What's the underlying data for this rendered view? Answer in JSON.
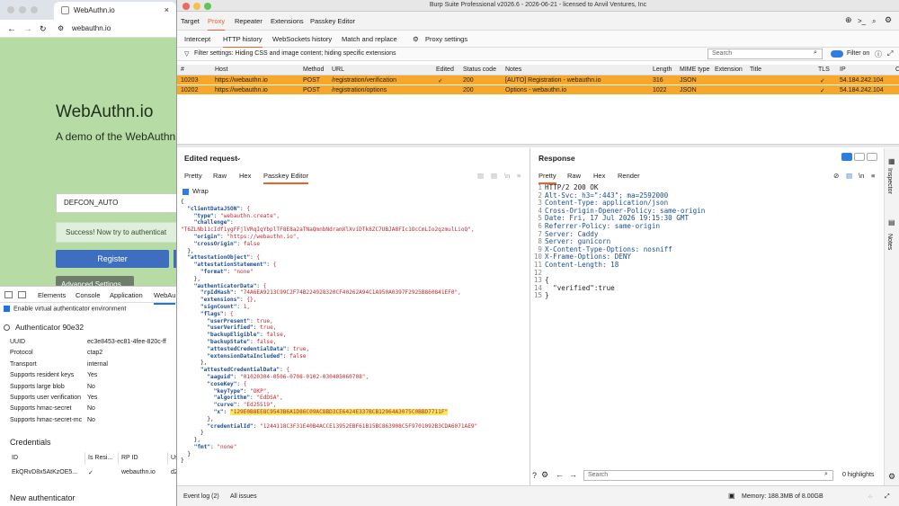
{
  "browser": {
    "tab_title": "WebAuthn.io",
    "address": "webauthn.io",
    "page": {
      "heading": "WebAuthn.io",
      "subheading": "A demo of the WebAuthn",
      "username_value": "DEFCON_AUTO",
      "success_text": "Success! Now try to authenticat",
      "register_label": "Register",
      "advanced_label": "Advanced Settings"
    },
    "devtools": {
      "tabs": [
        "Elements",
        "Console",
        "Application",
        "WebAu"
      ],
      "enable_checkbox_label": "Enable virtual authenticator environment",
      "authenticator_title": "Authenticator 90e32",
      "props": [
        {
          "k": "UUID",
          "v": "ec3e8453-ec81-4fee-820c-ff"
        },
        {
          "k": "Protocol",
          "v": "ctap2"
        },
        {
          "k": "Transport",
          "v": "internal"
        },
        {
          "k": "Supports resident keys",
          "v": "Yes"
        },
        {
          "k": "Supports large blob",
          "v": "No"
        },
        {
          "k": "Supports user verification",
          "v": "Yes"
        },
        {
          "k": "Supports hmac-secret",
          "v": "No"
        },
        {
          "k": "Supports hmac-secret-mc",
          "v": "No"
        }
      ],
      "credentials_title": "Credentials",
      "cred_headers": [
        "ID",
        "Is Resi...",
        "RP ID",
        "Us"
      ],
      "cred_row": [
        "EkQRvD8x5AtKzOE5...",
        "✓",
        "webauthn.io",
        "d2"
      ],
      "new_authenticator": "New authenticator"
    }
  },
  "burp": {
    "window_title": "Burp Suite Professional v2026.6 - 2026-06-21 - licensed to Anvil Ventures, Inc",
    "top_tabs": [
      "Target",
      "Proxy",
      "Repeater",
      "Extensions",
      "Passkey Editor"
    ],
    "active_top_tab": "Proxy",
    "sub_tabs": [
      "Intercept",
      "HTTP history",
      "WebSockets history",
      "Match and replace"
    ],
    "proxy_settings": "Proxy settings",
    "filter_text": "Filter settings: Hiding CSS and image content; hiding specific extensions",
    "search_placeholder": "Search",
    "filter_on_label": "Filter on",
    "history_columns": [
      "#",
      "Host",
      "Method",
      "URL",
      "Edited",
      "Status code",
      "Notes",
      "Length",
      "MIME type",
      "Extension",
      "Title",
      "TLS",
      "IP",
      "C"
    ],
    "history_rows": [
      {
        "num": "10203",
        "host": "https://webauthn.io",
        "method": "POST",
        "url": "/registration/verification",
        "edited": "✓",
        "status": "200",
        "notes": "[AUTO] Registration - webauthn.io",
        "length": "316",
        "mime": "JSON",
        "tls": "✓",
        "ip": "54.184.242.104"
      },
      {
        "num": "10202",
        "host": "https://webauthn.io",
        "method": "POST",
        "url": "/registration/options",
        "edited": "",
        "status": "200",
        "notes": "Options - webauthn.io",
        "length": "1022",
        "mime": "JSON",
        "tls": "✓",
        "ip": "54.184.242.104"
      }
    ],
    "request": {
      "title": "Edited request",
      "tabs": [
        "Pretty",
        "Raw",
        "Hex",
        "Passkey Editor"
      ],
      "active_tab": "Passkey Editor",
      "wrap_label": "Wrap",
      "json_lines": [
        "{",
        "  \"clientDataJSON\": {",
        "    \"type\": \"webauthn.create\",",
        "    \"challenge\":",
        "\"T6ZLNb11cIdf1ygFFjlVRqIqYbplTF8E8a2aTNaQmnbNdramXlXviDTk8ZC7UBJA8FIc1OcCmLIo2qzmulLioQ\",",
        "    \"origin\": \"https://webauthn.io\",",
        "    \"crossOrigin\": false",
        "  },",
        "  \"attestationObject\": {",
        "    \"attestationStatement\": {",
        "      \"format\": \"none\"",
        "    },",
        "    \"authenticatorData\": {",
        "      \"rpIdHash\": \"74A6EA9213C99C2F74B224928320CF40262A94C1A950A0397F2925B860841EF0\",",
        "      \"extensions\": {},",
        "      \"signCount\": 1,",
        "      \"flags\": {",
        "        \"userPresent\": true,",
        "        \"userVerified\": true,",
        "        \"backupEligible\": false,",
        "        \"backupState\": false,",
        "        \"attestedCredentialData\": true,",
        "        \"extensionDataIncluded\": false",
        "      },",
        "      \"attestedCredentialData\": {",
        "        \"aaguid\": \"01020304-0506-0708-0102-030405060708\",",
        "        \"coseKey\": {",
        "          \"keyType\": \"OKP\",",
        "          \"algorithm\": \"EdDSA\",",
        "          \"curve\": \"Ed25519\",",
        "          \"x\": \"129E0B8EE8C9543B6A1D86C09AC8BD3CE6424E337BCB12964A3075C0BBD7711F\"",
        "        },",
        "        \"credentialId\": \"1244118C3F31E40B4ACCE13952EBF61B15BC863908C5F9701092B3CDA6071AE9\"",
        "      }",
        "    },",
        "    \"fmt\": \"none\"",
        "  }",
        "}"
      ]
    },
    "response": {
      "title": "Response",
      "tabs": [
        "Pretty",
        "Raw",
        "Hex",
        "Render"
      ],
      "active_tab": "Pretty",
      "lines": [
        "HTTP/2 200 OK",
        "Alt-Svc: h3=\":443\"; ma=2592000",
        "Content-Type: application/json",
        "Cross-Origin-Opener-Policy: same-origin",
        "Date: Fri, 17 Jul 2026 19:15:30 GMT",
        "Referrer-Policy: same-origin",
        "Server: Caddy",
        "Server: gunicorn",
        "X-Content-Type-Options: nosniff",
        "X-Frame-Options: DENY",
        "Content-Length: 18",
        "",
        "{",
        "  \"verified\":true",
        "}"
      ],
      "search_placeholder": "Search",
      "highlights": "0 highlights"
    },
    "side_tabs": [
      "Inspector",
      "Notes"
    ],
    "status": {
      "event_log": "Event log (2)",
      "all_issues": "All issues",
      "memory": "Memory: 188.3MB of 8.00GB"
    },
    "colors": {
      "accent": "#e8642c",
      "row_highlight": "#f7a82a",
      "page_bg": "#b7dba4"
    }
  }
}
